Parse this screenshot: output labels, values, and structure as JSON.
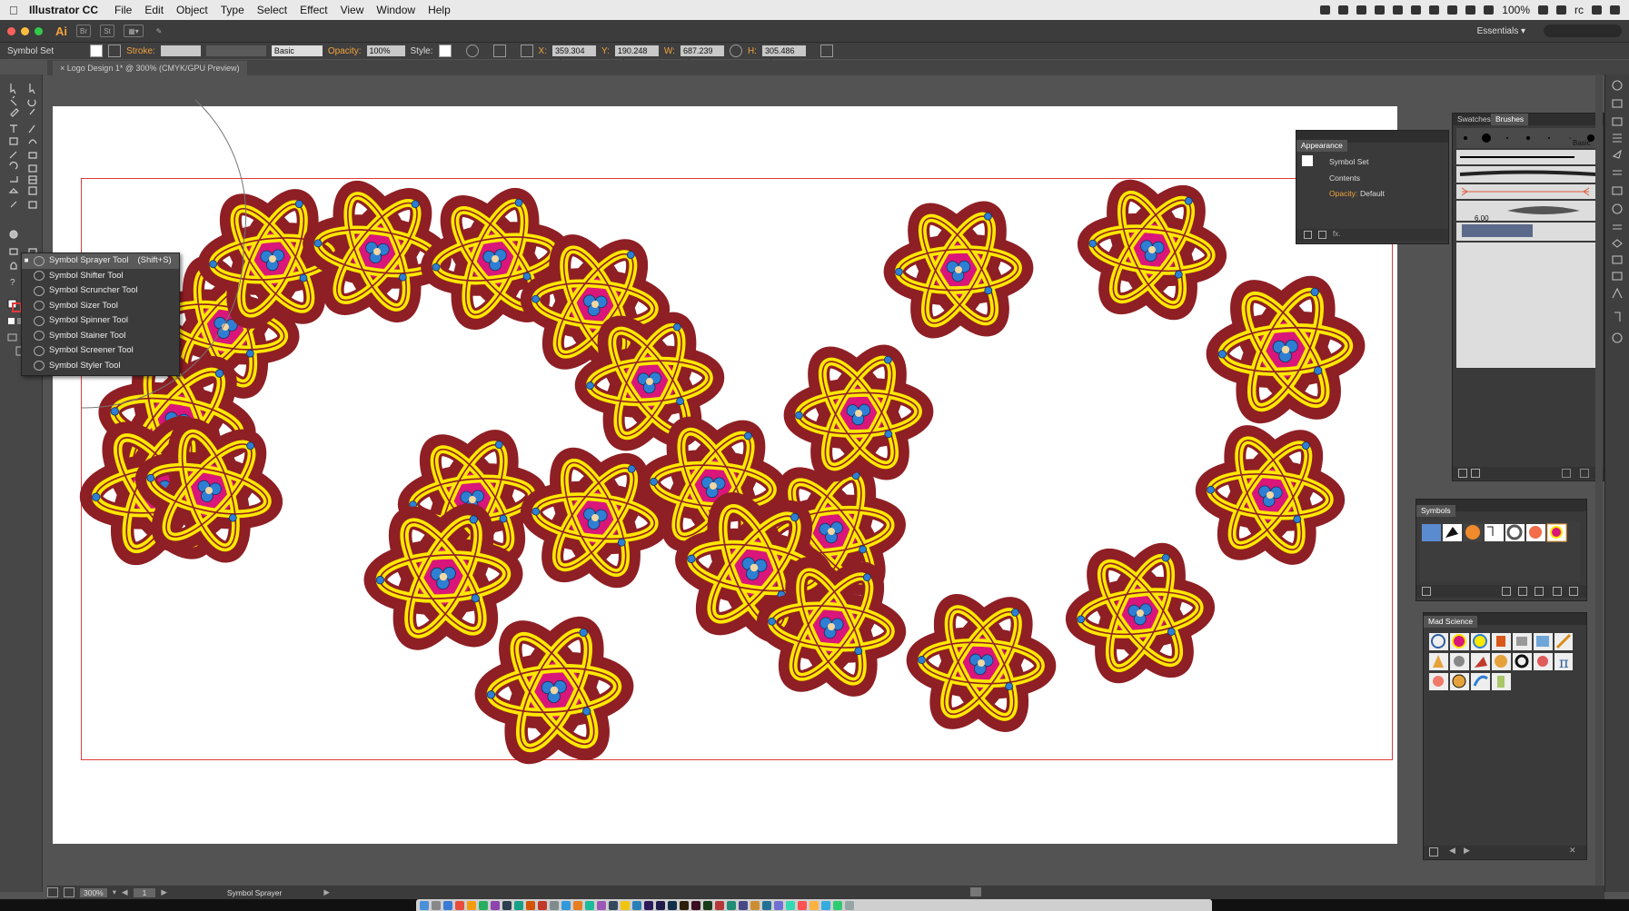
{
  "menubar": {
    "app_name": "Illustrator CC",
    "items": [
      "File",
      "Edit",
      "Object",
      "Type",
      "Select",
      "Effect",
      "View",
      "Window",
      "Help"
    ],
    "battery": "100%",
    "user": "rc"
  },
  "appbar": {
    "logo": "Ai",
    "br": "Br",
    "st": "St",
    "workspace": "Essentials ▾"
  },
  "controlbar": {
    "selection": "Symbol Set",
    "stroke_label": "Stroke:",
    "brush_label": "Basic",
    "opacity_label": "Opacity:",
    "opacity_value": "100%",
    "style_label": "Style:",
    "x_label": "X:",
    "x_value": "359.304 pt",
    "y_label": "Y:",
    "y_value": "190.248 pt",
    "w_label": "W:",
    "w_value": "687.239 pt",
    "h_label": "H:",
    "h_value": "305.486 pt"
  },
  "document": {
    "tab_title": "Logo Design 1* @ 300% (CMYK/GPU Preview)"
  },
  "flyout": {
    "items": [
      {
        "label": "Symbol Sprayer Tool",
        "shortcut": "(Shift+S)",
        "selected": true
      },
      {
        "label": "Symbol Shifter Tool",
        "shortcut": "",
        "selected": false
      },
      {
        "label": "Symbol Scruncher Tool",
        "shortcut": "",
        "selected": false
      },
      {
        "label": "Symbol Sizer Tool",
        "shortcut": "",
        "selected": false
      },
      {
        "label": "Symbol Spinner Tool",
        "shortcut": "",
        "selected": false
      },
      {
        "label": "Symbol Stainer Tool",
        "shortcut": "",
        "selected": false
      },
      {
        "label": "Symbol Screener Tool",
        "shortcut": "",
        "selected": false
      },
      {
        "label": "Symbol Styler Tool",
        "shortcut": "",
        "selected": false
      }
    ]
  },
  "appearance": {
    "title": "Appearance",
    "item": "Symbol Set",
    "contents": "Contents",
    "opacity_label": "Opacity:",
    "opacity_value": "Default"
  },
  "brushes": {
    "tab_swatches": "Swatches",
    "tab_brushes": "Brushes",
    "basic": "Basic",
    "size": "6.00"
  },
  "symbols": {
    "title": "Symbols"
  },
  "library": {
    "title": "Mad Science"
  },
  "status": {
    "zoom": "300%",
    "page": "1",
    "tool": "Symbol Sprayer"
  },
  "colors": {
    "atom_outline": "#8e1f24",
    "atom_ring": "#ffe800",
    "atom_core": "#d9167a",
    "atom_nucleus": "#2e7fd4",
    "bleed": "#e23a3a",
    "accent": "#f3a33d"
  }
}
